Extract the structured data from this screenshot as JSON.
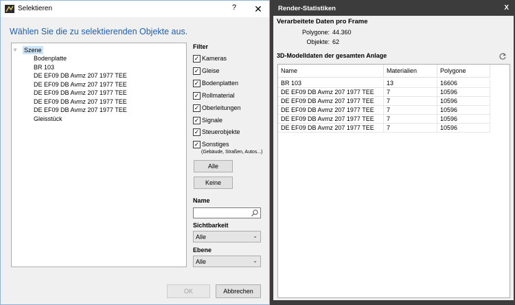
{
  "dialog": {
    "title": "Selektieren",
    "help": "?",
    "close": "✕",
    "heading": "Wählen Sie die zu selektierenden Objekte aus.",
    "tree": {
      "root": "Szene",
      "toggle": "▿",
      "children": [
        "Bodenplatte",
        "BR 103",
        "DE EF09 DB Avmz 207 1977 TEE",
        "DE EF09 DB Avmz 207 1977 TEE",
        "DE EF09 DB Avmz 207 1977 TEE",
        "DE EF09 DB Avmz 207 1977 TEE",
        "DE EF09 DB Avmz 207 1977 TEE",
        "Gleisstück"
      ]
    },
    "filter": {
      "title": "Filter",
      "items": [
        {
          "label": "Kameras",
          "checked": "✓"
        },
        {
          "label": "Gleise",
          "checked": "✓"
        },
        {
          "label": "Bodenplatten",
          "checked": "✓"
        },
        {
          "label": "Rollmaterial",
          "checked": "✓"
        },
        {
          "label": "Oberleitungen",
          "checked": "✓"
        },
        {
          "label": "Signale",
          "checked": "✓"
        },
        {
          "label": "Steuerobjekte",
          "checked": "✓"
        },
        {
          "label": "Sonstiges",
          "checked": "✓"
        }
      ],
      "note": "(Gebäude, Straßen, Autos...)",
      "all_button": "Alle",
      "none_button": "Keine"
    },
    "name": {
      "title": "Name",
      "value": ""
    },
    "visibility": {
      "title": "Sichtbarkeit",
      "value": "Alle"
    },
    "layer": {
      "title": "Ebene",
      "value": "Alle"
    },
    "ok": "OK",
    "cancel": "Abbrechen"
  },
  "render_stats": {
    "title": "Render-Statistiken",
    "close": "X",
    "frame_heading": "Verarbeitete Daten pro Frame",
    "polygons_label": "Polygone:",
    "polygons_value": "44.360",
    "objects_label": "Objekte:",
    "objects_value": "62",
    "model_heading": "3D-Modelldaten der gesamten Anlage",
    "columns": [
      "Name",
      "Materialien",
      "Polygone"
    ],
    "rows": [
      [
        "BR 103",
        "13",
        "16606"
      ],
      [
        "DE EF09 DB Avmz 207 1977 TEE",
        "7",
        "10596"
      ],
      [
        "DE EF09 DB Avmz 207 1977 TEE",
        "7",
        "10596"
      ],
      [
        "DE EF09 DB Avmz 207 1977 TEE",
        "7",
        "10596"
      ],
      [
        "DE EF09 DB Avmz 207 1977 TEE",
        "7",
        "10596"
      ],
      [
        "DE EF09 DB Avmz 207 1977 TEE",
        "7",
        "10596"
      ]
    ]
  },
  "colors": {
    "heading": "#1f5ea8",
    "selection": "#cce4f7",
    "panel_dark": "#3c3c3c"
  }
}
